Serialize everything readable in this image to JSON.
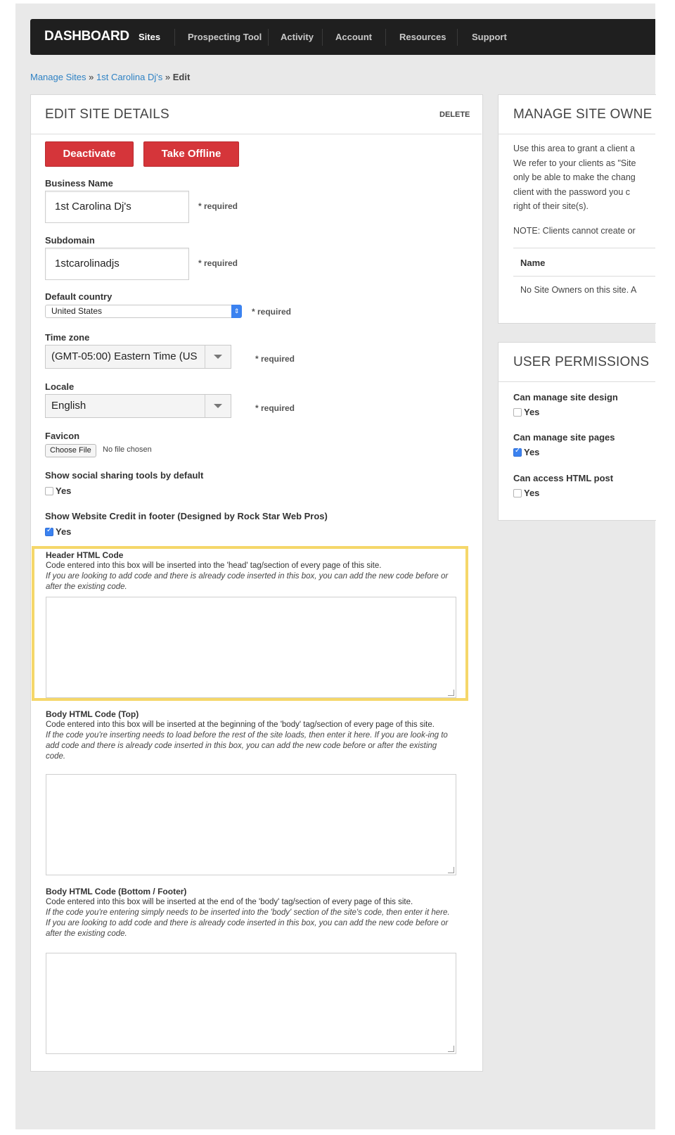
{
  "navbar": {
    "brand": "DASHBOARD",
    "items": [
      "Sites",
      "Prospecting Tool",
      "Activity",
      "Account",
      "Resources",
      "Support"
    ],
    "active": "Sites"
  },
  "breadcrumb": {
    "items": [
      "Manage Sites",
      "1st Carolina Dj's"
    ],
    "separator": "»",
    "current": "Edit"
  },
  "edit_panel": {
    "title": "EDIT SITE DETAILS",
    "delete_label": "DELETE",
    "deactivate_label": "Deactivate",
    "take_offline_label": "Take Offline",
    "business_name_label": "Business Name",
    "business_name_value": "1st Carolina Dj's",
    "subdomain_label": "Subdomain",
    "subdomain_value": "1stcarolinadjs",
    "required_text": "* required",
    "default_country_label": "Default country",
    "default_country_value": "United States",
    "time_zone_label": "Time zone",
    "time_zone_value": "(GMT-05:00) Eastern Time (US",
    "locale_label": "Locale",
    "locale_value": "English",
    "favicon_label": "Favicon",
    "choose_file_label": "Choose File",
    "no_file_text": "No file chosen",
    "social_sharing_label": "Show social sharing tools by default",
    "social_sharing_checked": false,
    "website_credit_label": "Show Website Credit in footer (Designed by Rock Star Web Pros)",
    "website_credit_checked": true,
    "yes_label": "Yes"
  },
  "header_code": {
    "title": "Header HTML Code",
    "desc": "Code entered into this box will be inserted into the 'head' tag/section of every page of this site.",
    "note": "If you are looking to add code and there is already code inserted in this box, you can add the new code before or after the existing code."
  },
  "body_top_code": {
    "title": "Body HTML Code (Top)",
    "desc": "Code entered into this box will be inserted at the beginning of the 'body' tag/section of every page of this site.",
    "note": "If the code you're inserting needs to load before the rest of the site loads, then enter it here. If you are look-ing to add code and there is already code inserted in this box, you can add the new code before or after the existing code."
  },
  "body_bottom_code": {
    "title": "Body HTML Code (Bottom / Footer)",
    "desc": "Code entered into this box will be inserted at the end of the 'body' tag/section of every page of this site.",
    "note": "If the code you're entering simply needs to be inserted into the 'body' section of the site's code, then enter it here. If you are looking to add code and there is already code inserted in this box, you can add the new code before or after the existing code."
  },
  "owners_panel": {
    "title": "MANAGE SITE OWNE",
    "desc_lines": [
      "Use this area to grant a client a",
      "We refer to your clients as \"Site",
      "only be able to make the chang",
      "client with the password you c",
      "right of their site(s)."
    ],
    "note": "NOTE: Clients cannot create or",
    "name_header": "Name",
    "empty_text": "No Site Owners on this site. A"
  },
  "permissions_panel": {
    "title": "USER PERMISSIONS",
    "items": [
      {
        "label": "Can manage site design",
        "checked": false
      },
      {
        "label": "Can manage site pages",
        "checked": true
      },
      {
        "label": "Can access HTML post",
        "checked": false
      }
    ],
    "yes_label": "Yes"
  }
}
